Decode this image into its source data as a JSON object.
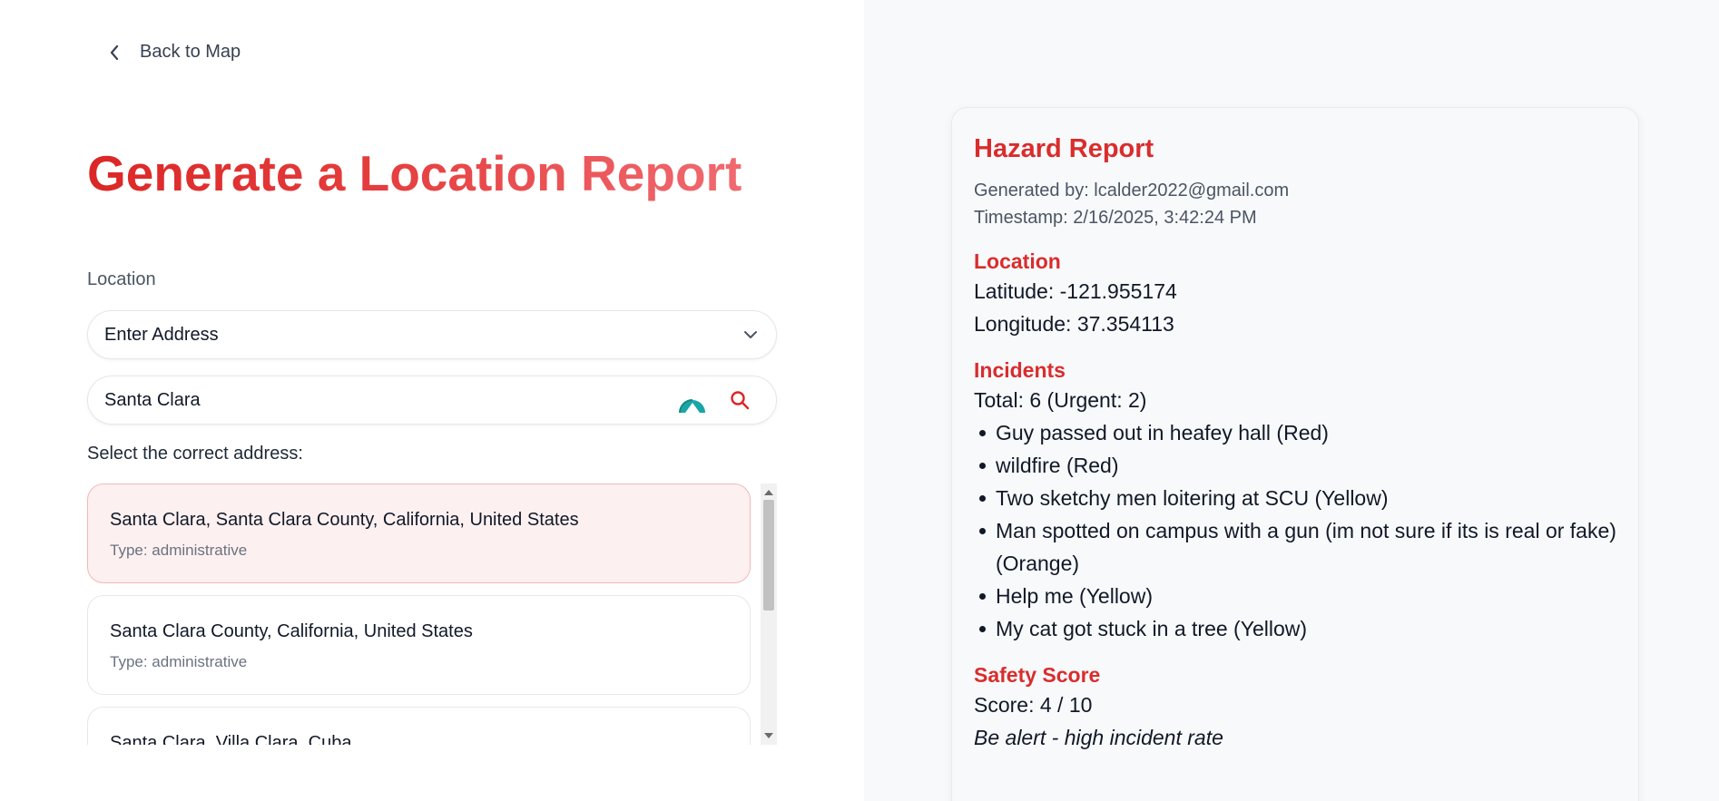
{
  "nav": {
    "back_label": "Back to Map"
  },
  "form": {
    "title": "Generate a Location Report",
    "location_label": "Location",
    "mode_select_value": "Enter Address",
    "search_value": "Santa Clara",
    "select_hint": "Select the correct address:",
    "results": [
      {
        "address": "Santa Clara, Santa Clara County, California, United States",
        "type": "Type: administrative",
        "selected": true
      },
      {
        "address": "Santa Clara County, California, United States",
        "type": "Type: administrative",
        "selected": false
      },
      {
        "address": "Santa Clara, Villa Clara, Cuba",
        "type": "",
        "selected": false
      }
    ]
  },
  "report": {
    "title": "Hazard Report",
    "generated_by": "Generated by: lcalder2022@gmail.com",
    "timestamp": "Timestamp: 2/16/2025, 3:42:24 PM",
    "location": {
      "heading": "Location",
      "latitude": "Latitude: -121.955174",
      "longitude": "Longitude: 37.354113"
    },
    "incidents": {
      "heading": "Incidents",
      "total": "Total: 6 (Urgent: 2)",
      "items": [
        "Guy passed out in heafey hall (Red)",
        "wildfire (Red)",
        "Two sketchy men loitering at SCU (Yellow)",
        "Man spotted on campus with a gun (im not sure if its is real or fake) (Orange)",
        "Help me (Yellow)",
        "My cat got stuck in a tree (Yellow)"
      ]
    },
    "safety": {
      "heading": "Safety Score",
      "score": "Score: 4 / 10",
      "note": "Be alert - high incident rate"
    }
  },
  "colors": {
    "accent": "#d92d2d",
    "selected_bg": "#fdf0f0",
    "right_panel_bg": "#f8f9fb"
  },
  "icons": {
    "back": "chevron-left-icon",
    "dropdown": "chevron-down-icon",
    "extension": "teal-extension-icon",
    "search": "search-icon"
  }
}
